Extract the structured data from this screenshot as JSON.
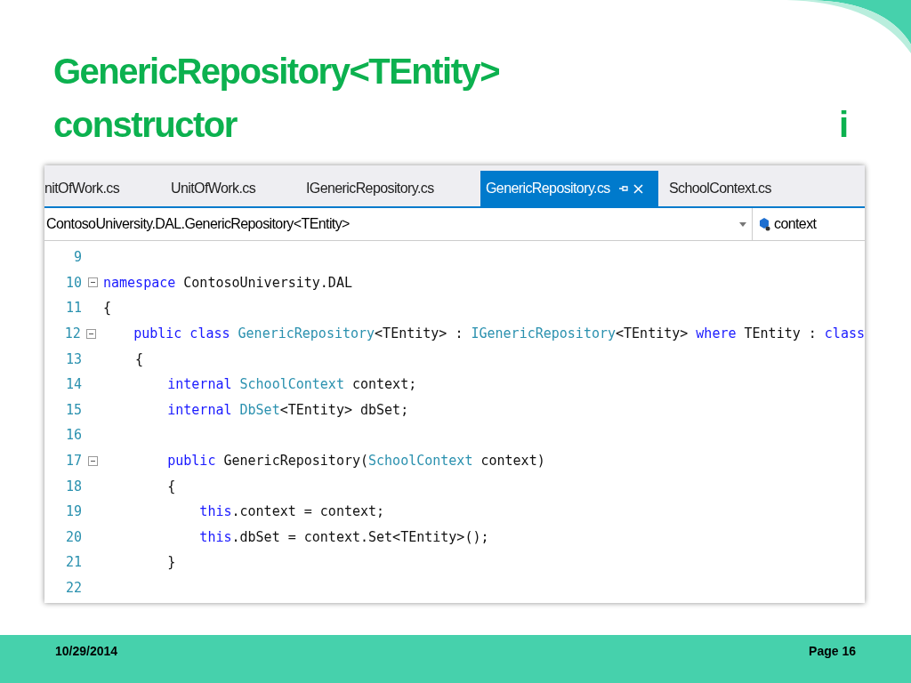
{
  "slide": {
    "title": "GenericRepository<TEntity> constructor",
    "title_mark": "i"
  },
  "editor": {
    "tabs": [
      {
        "label": "nitOfWork.cs",
        "selected": false
      },
      {
        "label": "UnitOfWork.cs",
        "selected": false
      },
      {
        "label": "IGenericRepository.cs",
        "selected": false
      },
      {
        "label": "GenericRepository.cs",
        "selected": true
      },
      {
        "label": "SchoolContext.cs",
        "selected": false
      }
    ],
    "nav_left": "ContosoUniversity.DAL.GenericRepository<TEntity>",
    "nav_right": "context",
    "lines": [
      {
        "number": "9",
        "foldable": false
      },
      {
        "number": "10",
        "foldable": true,
        "tokens": [
          {
            "text": "namespace",
            "kind": "keyword"
          },
          {
            "text": " ContosoUniversity.DAL",
            "kind": "plain"
          }
        ]
      },
      {
        "number": "11",
        "foldable": false,
        "tokens": [
          {
            "text": "{",
            "kind": "plain"
          }
        ]
      },
      {
        "number": "12",
        "foldable": true,
        "tokens": [
          {
            "text": "    public class",
            "kind": "keyword"
          },
          {
            "text": " GenericRepository",
            "kind": "type"
          },
          {
            "text": "<TEntity> : ",
            "kind": "plain"
          },
          {
            "text": "IGenericRepository",
            "kind": "type"
          },
          {
            "text": "<TEntity> ",
            "kind": "plain"
          },
          {
            "text": "where",
            "kind": "keyword"
          },
          {
            "text": " TEntity : ",
            "kind": "plain"
          },
          {
            "text": "class",
            "kind": "keyword"
          }
        ]
      },
      {
        "number": "13",
        "foldable": false,
        "tokens": [
          {
            "text": "    {",
            "kind": "plain"
          }
        ]
      },
      {
        "number": "14",
        "foldable": false,
        "tokens": [
          {
            "text": "        internal",
            "kind": "keyword"
          },
          {
            "text": " SchoolContext",
            "kind": "type"
          },
          {
            "text": " context;",
            "kind": "plain"
          }
        ]
      },
      {
        "number": "15",
        "foldable": false,
        "tokens": [
          {
            "text": "        internal",
            "kind": "keyword"
          },
          {
            "text": " DbSet",
            "kind": "type"
          },
          {
            "text": "<TEntity> dbSet;",
            "kind": "plain"
          }
        ]
      },
      {
        "number": "16",
        "foldable": false
      },
      {
        "number": "17",
        "foldable": true,
        "tokens": [
          {
            "text": "        public",
            "kind": "keyword"
          },
          {
            "text": " GenericRepository(",
            "kind": "plain"
          },
          {
            "text": "SchoolContext",
            "kind": "type"
          },
          {
            "text": " context)",
            "kind": "plain"
          }
        ]
      },
      {
        "number": "18",
        "foldable": false,
        "tokens": [
          {
            "text": "        {",
            "kind": "plain"
          }
        ]
      },
      {
        "number": "19",
        "foldable": false,
        "tokens": [
          {
            "text": "            this",
            "kind": "keyword"
          },
          {
            "text": ".context = context;",
            "kind": "plain"
          }
        ]
      },
      {
        "number": "20",
        "foldable": false,
        "tokens": [
          {
            "text": "            this",
            "kind": "keyword"
          },
          {
            "text": ".dbSet = context.Set<TEntity>();",
            "kind": "plain"
          }
        ]
      },
      {
        "number": "21",
        "foldable": false,
        "tokens": [
          {
            "text": "        }",
            "kind": "plain"
          }
        ]
      },
      {
        "number": "22",
        "foldable": false
      }
    ]
  },
  "footer": {
    "date": "10/29/2014",
    "page": "Page 16"
  }
}
